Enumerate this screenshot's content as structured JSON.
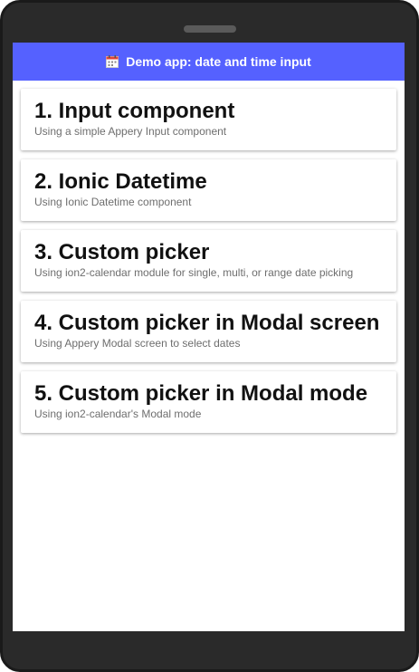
{
  "header": {
    "icon": "calendar-icon",
    "title": "Demo app: date and time input",
    "color": "#5561ff"
  },
  "items": [
    {
      "title": "1. Input component",
      "subtitle": "Using a simple Appery Input component"
    },
    {
      "title": "2. Ionic Datetime",
      "subtitle": "Using Ionic Datetime component"
    },
    {
      "title": "3. Custom picker",
      "subtitle": "Using ion2-calendar module for single, multi, or range date picking"
    },
    {
      "title": "4. Custom picker in Modal screen",
      "subtitle": "Using Appery Modal screen to select dates"
    },
    {
      "title": "5. Custom picker in Modal mode",
      "subtitle": "Using ion2-calendar's Modal mode"
    }
  ]
}
